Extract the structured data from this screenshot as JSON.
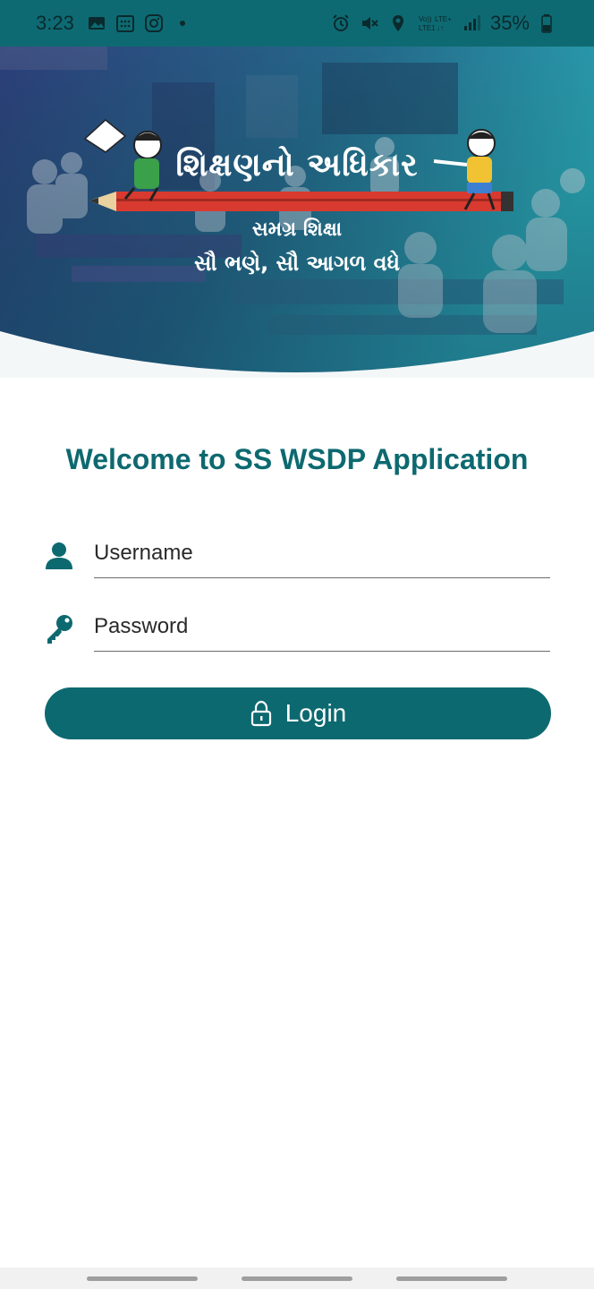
{
  "status_bar": {
    "time": "3:23",
    "battery": "35%",
    "icons": [
      "gallery-icon",
      "calendar-icon",
      "instagram-icon",
      "dot-icon",
      "alarm-icon",
      "mute-icon",
      "location-icon",
      "volte-icon",
      "signal-icon",
      "battery-icon"
    ]
  },
  "banner": {
    "title": "શિક્ષણનો અધિકાર",
    "subtitle": "સમગ્ર શિક્ષા",
    "tagline": "સૌ ભણે, સૌ આગળ વધે"
  },
  "welcome_text": "Welcome to SS WSDP Application",
  "form": {
    "username_placeholder": "Username",
    "password_placeholder": "Password",
    "login_label": "Login"
  },
  "colors": {
    "primary": "#0d6970",
    "status_bar": "#0e6a72"
  }
}
